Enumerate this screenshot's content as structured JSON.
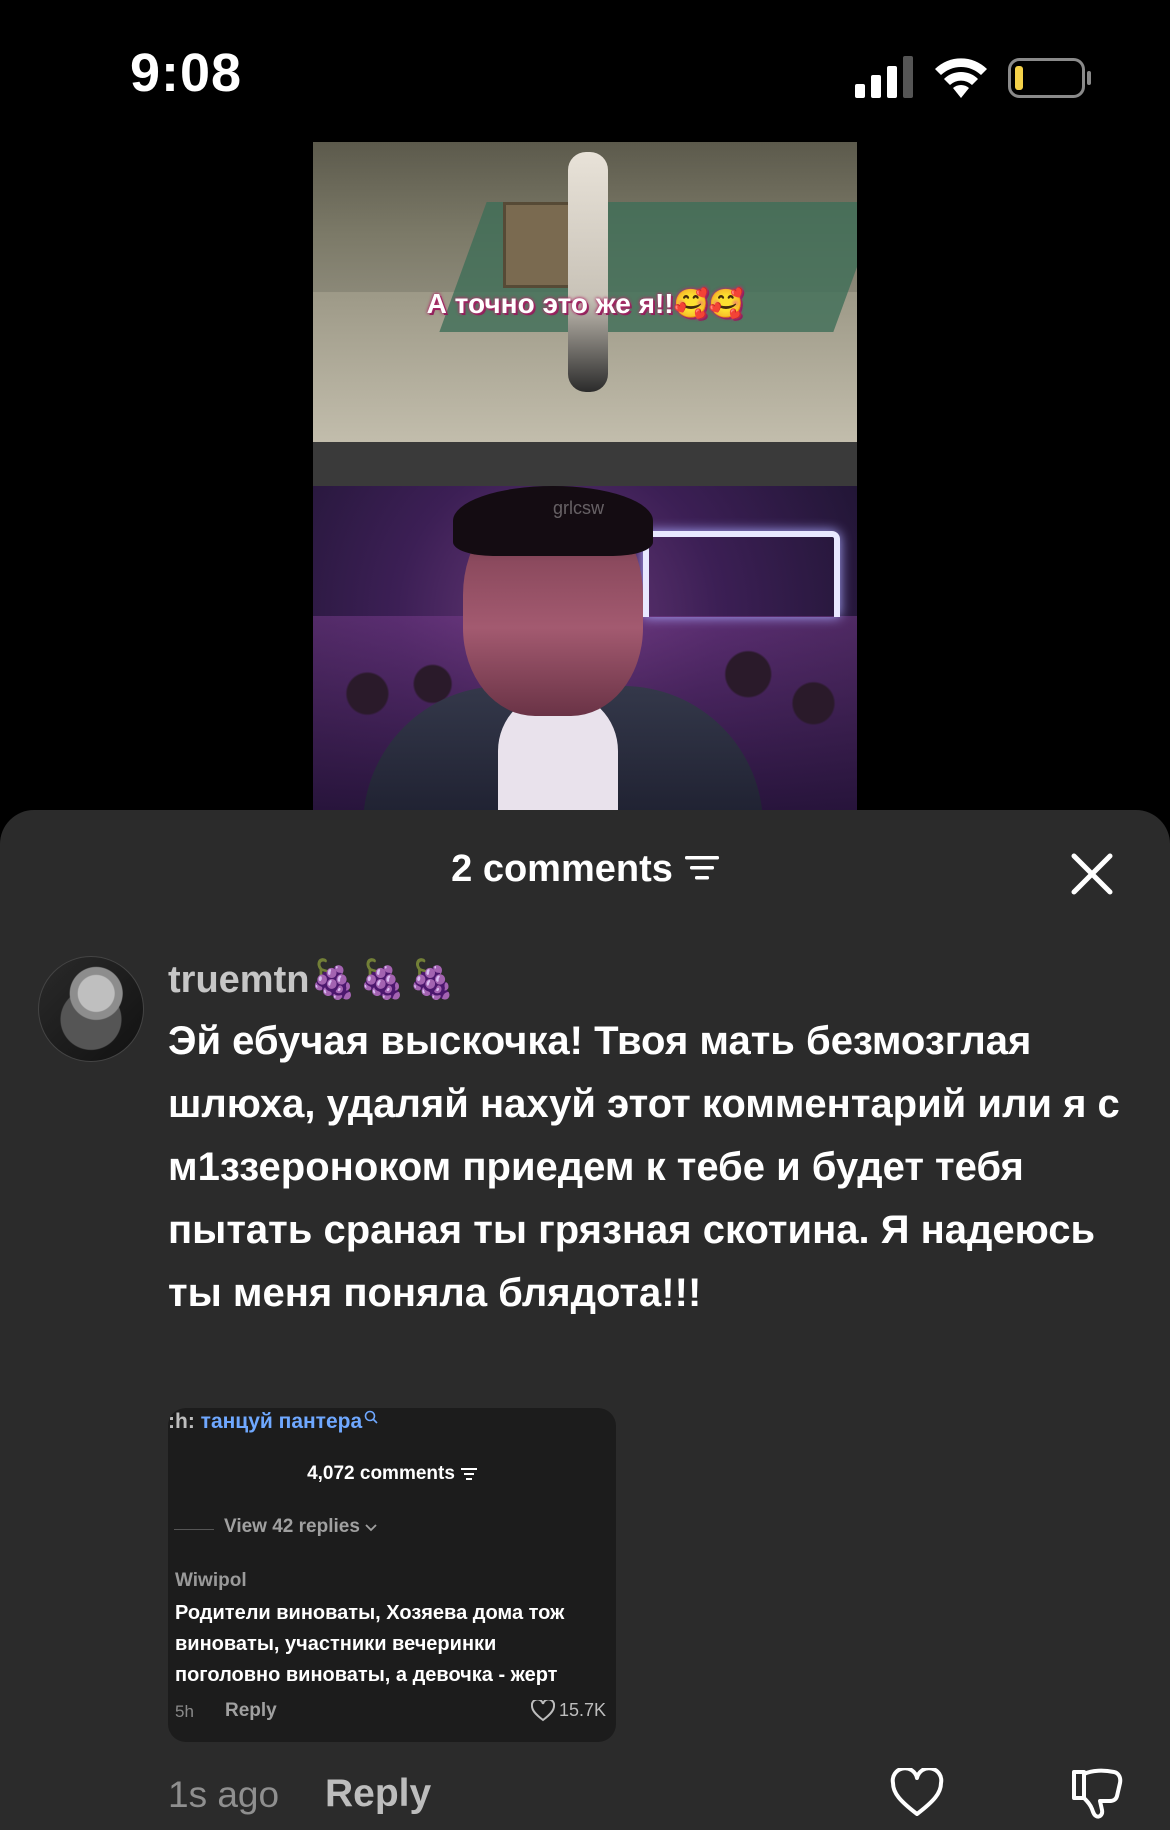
{
  "status_bar": {
    "time": "9:08",
    "icons": [
      "signal-icon",
      "wifi-icon",
      "battery-icon"
    ]
  },
  "video": {
    "caption": "А точно это же я!!🥰🥰",
    "watermark": "grlcsw"
  },
  "comments_sheet": {
    "title": "2 comments",
    "comments": [
      {
        "username": "truemtn",
        "username_emoji": "🍇🍇🍇",
        "text": "Эй ебучая выскочка! Твоя мать безмозглая шлюха, удаляй нахуй этот комментарий или я с м1ззероноком приедем к тебе и будет тебя пытать сраная ты грязная скотина. Я надеюсь ты меня поняла блядота!!!",
        "time": "1s ago",
        "reply_label": "Reply",
        "attached_image": {
          "search_prefix": ":h: ",
          "search_term": "танцуй пантера",
          "comment_count": "4,072 comments",
          "view_replies": "View 42 replies",
          "author": "Wiwipol",
          "body": "Родители виноваты, Хозяева дома тож\nвиноваты, участники вечеринки\nпоголовно виноваты, а девочка - жерт",
          "time": "5h",
          "reply_label": "Reply",
          "likes": "15.7K"
        }
      }
    ]
  },
  "colors": {
    "sheet_bg": "#2b2b2b",
    "link_blue": "#6fa8ff"
  }
}
